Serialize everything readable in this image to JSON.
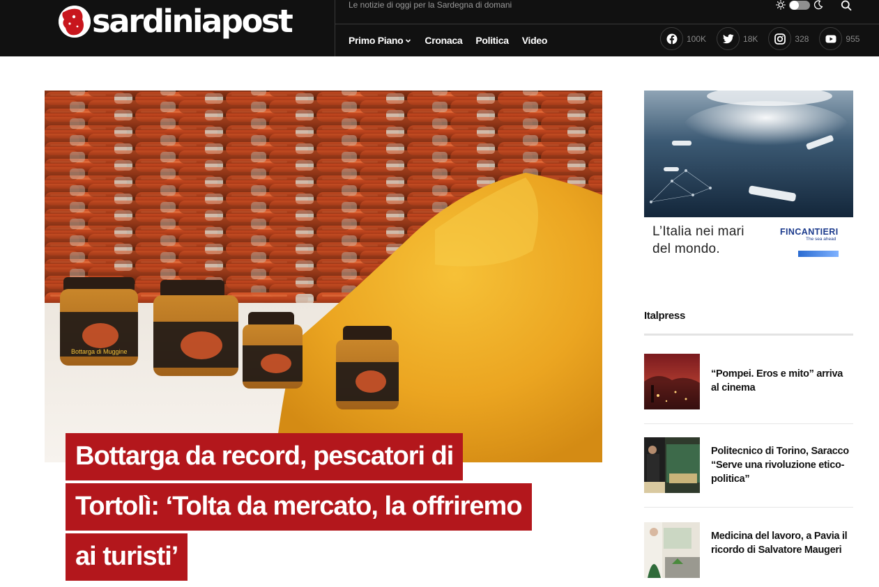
{
  "header": {
    "logo_text": "sardiniapost",
    "tagline": "Le notizie di oggi per la Sardegna di domani",
    "nav": [
      {
        "label": "Primo Piano",
        "has_dropdown": true
      },
      {
        "label": "Cronaca",
        "has_dropdown": false
      },
      {
        "label": "Politica",
        "has_dropdown": false
      },
      {
        "label": "Video",
        "has_dropdown": false
      }
    ],
    "social": [
      {
        "network": "facebook",
        "icon": "facebook-icon",
        "count": "100K"
      },
      {
        "network": "twitter",
        "icon": "twitter-icon",
        "count": "18K"
      },
      {
        "network": "instagram",
        "icon": "instagram-icon",
        "count": "328"
      },
      {
        "network": "youtube",
        "icon": "youtube-icon",
        "count": "955"
      }
    ]
  },
  "article": {
    "headline_lines": [
      "Bottarga da record, pescatori di",
      "Tortolì: ‘Tolta da mercato, la offriremo",
      "ai turisti’"
    ],
    "hero_jar_label": "Bottarga di Muggine",
    "accent_color": "#b3171c"
  },
  "sidebar": {
    "ad": {
      "text_line1": "L’Italia nei mari",
      "text_line2": "del mondo.",
      "brand": "FINCANTIERI",
      "brand_sub": "The sea ahead"
    },
    "section_title": "Italpress",
    "items": [
      {
        "title": "“Pompei. Eros e mito” arriva al cinema"
      },
      {
        "title": "Politecnico di Torino, Saracco “Serve una rivoluzione etico-politica”"
      },
      {
        "title": "Medicina del lavoro, a Pavia il ricordo di Salvatore Maugeri"
      }
    ]
  }
}
